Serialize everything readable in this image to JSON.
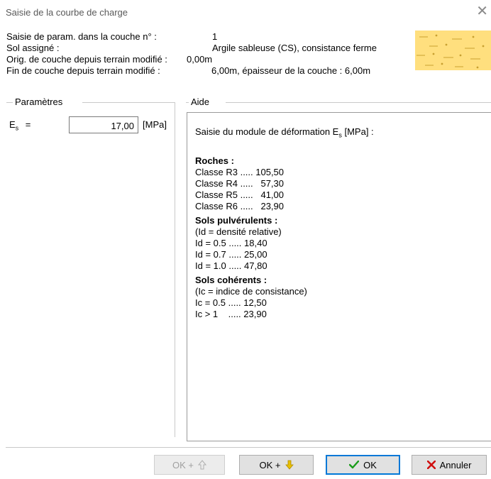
{
  "window": {
    "title": "Saisie de la courbe de charge",
    "close_glyph": "✕"
  },
  "info": {
    "rows": [
      {
        "label": "Saisie de param. dans la couche n° :",
        "value": "1"
      },
      {
        "label": "Sol assigné :",
        "value": "Argile sableuse (CS), consistance ferme"
      },
      {
        "label": "Orig. de couche depuis terrain modifié :",
        "value": "0,00m"
      },
      {
        "label": "Fin de couche depuis terrain modifié :",
        "value": "6,00m, épaisseur de la couche : 6,00m"
      }
    ],
    "swatch_color": "#ffdf7e",
    "swatch_icon": "soil-pattern-icon"
  },
  "parametres": {
    "title": "Paramètres",
    "es_symbol": "E",
    "es_subscript": "s",
    "es_equals": "=",
    "es_value": "17,00",
    "es_unit": "[MPa]"
  },
  "aide": {
    "title": "Aide",
    "intro_prefix": "Saisie du module de déformation E",
    "intro_sub": "s",
    "intro_suffix": " [MPa] :",
    "roches_header": "Roches :",
    "roches": [
      "Classe R3 ..... 105,50",
      "Classe R4 .....   57,30",
      "Classe R5 .....   41,00",
      "Classe R6 .....   23,90"
    ],
    "pulv_header": "Sols pulvérulents :",
    "pulv_note": "(Id = densité relative)",
    "pulv": [
      "Id = 0.5 ..... 18,40",
      "Id = 0.7 ..... 25,00",
      "Id = 1.0 ..... 47,80"
    ],
    "coh_header": "Sols cohérents :",
    "coh_note": "(Ic = indice de consistance)",
    "coh": [
      "Ic = 0.5 ..... 12,50",
      "Ic > 1    ..... 23,90"
    ]
  },
  "buttons": {
    "ok_up": "OK +",
    "ok_down": "OK +",
    "ok": "OK",
    "cancel": "Annuler"
  },
  "colors": {
    "accent": "#0078d7",
    "ok_down_arrow": "#e0b000",
    "ok_check": "#1a9c1a",
    "cancel_x": "#d01010"
  }
}
